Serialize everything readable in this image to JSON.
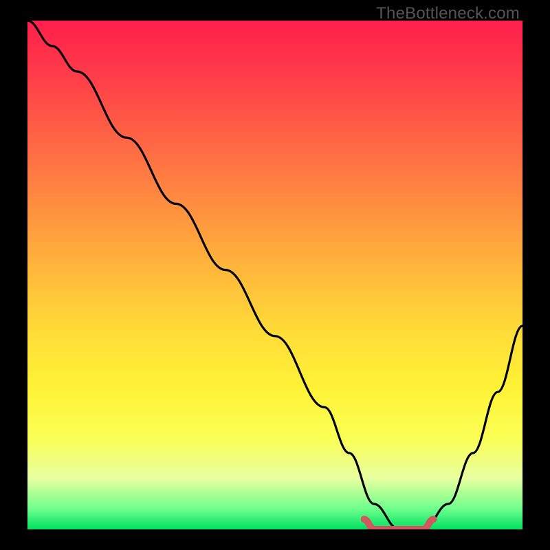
{
  "watermark": "TheBottleneck.com",
  "chart_data": {
    "type": "line",
    "title": "",
    "xlabel": "",
    "ylabel": "",
    "xlim": [
      0,
      100
    ],
    "ylim": [
      0,
      100
    ],
    "grid": false,
    "legend": false,
    "series": [
      {
        "name": "bottleneck-curve",
        "color": "#000000",
        "x": [
          0,
          5,
          10,
          20,
          30,
          40,
          50,
          60,
          65,
          70,
          75,
          80,
          85,
          90,
          95,
          100
        ],
        "y": [
          100,
          95,
          90,
          77,
          64,
          51,
          38,
          24,
          15,
          5,
          0,
          0,
          5,
          15,
          27,
          40
        ]
      },
      {
        "name": "optimal-region",
        "color": "#d1585e",
        "x": [
          68,
          70,
          72,
          74,
          76,
          78,
          80,
          82
        ],
        "y": [
          2,
          0,
          0,
          0,
          0,
          0,
          0,
          2
        ]
      }
    ],
    "background_gradient": {
      "stops": [
        {
          "pos": 0.0,
          "color": "#ff1f4b"
        },
        {
          "pos": 0.5,
          "color": "#ffba3a"
        },
        {
          "pos": 0.8,
          "color": "#faff55"
        },
        {
          "pos": 1.0,
          "color": "#00e060"
        }
      ]
    }
  }
}
